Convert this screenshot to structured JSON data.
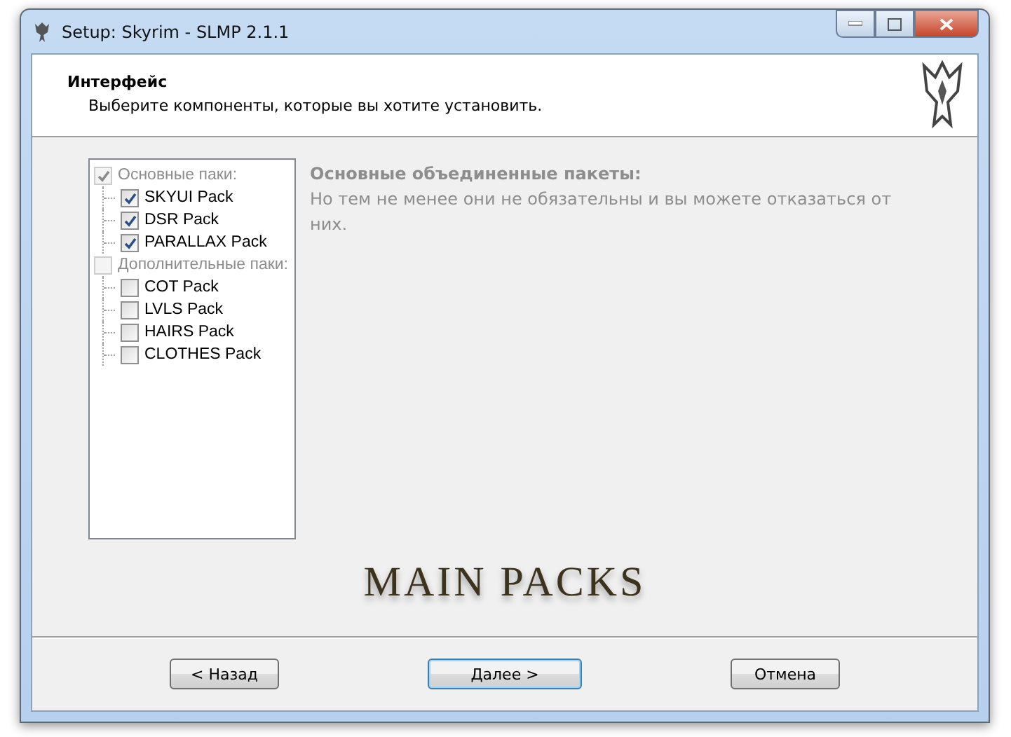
{
  "window": {
    "title": "Setup: Skyrim - SLMP 2.1.1"
  },
  "header": {
    "title": "Интерфейс",
    "subtitle": "Выберите компоненты, которые вы хотите установить."
  },
  "tree": [
    {
      "label": "Основные паки:",
      "checked": true,
      "children": [
        {
          "label": "SKYUI Pack",
          "checked": true
        },
        {
          "label": "DSR Pack",
          "checked": true
        },
        {
          "label": "PARALLAX Pack",
          "checked": true
        }
      ]
    },
    {
      "label": "Дополнительные паки:",
      "checked": false,
      "children": [
        {
          "label": "COT Pack",
          "checked": false
        },
        {
          "label": "LVLS Pack",
          "checked": false
        },
        {
          "label": "HAIRS Pack",
          "checked": false
        },
        {
          "label": "CLOTHES Pack",
          "checked": false
        }
      ]
    }
  ],
  "description": {
    "title": "Основные объединенные пакеты:",
    "text": "Но тем не менее они не обязательны и вы можете отказаться от них."
  },
  "banner": "MAIN PACKS",
  "buttons": [
    {
      "label": "< Назад",
      "focused": false
    },
    {
      "label": "Далее >",
      "focused": true
    },
    {
      "label": "Отмена",
      "focused": false
    }
  ]
}
